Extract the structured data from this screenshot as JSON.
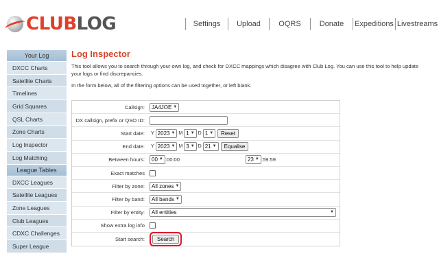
{
  "logo": {
    "club": "CLUB",
    "log": "LOG"
  },
  "topnav": [
    "Settings",
    "Upload",
    "OQRS",
    "Donate",
    "Expeditions",
    "Livestreams"
  ],
  "sidebar": {
    "your_log_header": "Your Log",
    "your_log_items": [
      "DXCC Charts",
      "Satellite Charts",
      "Timelines",
      "Grid Squares",
      "QSL Charts",
      "Zone Charts",
      "Log Inspector",
      "Log Matching"
    ],
    "league_header": "League Tables",
    "league_items": [
      "DXCC Leagues",
      "Satellite Leagues",
      "Zone Leagues",
      "Club Leagues",
      "CDXC Challenges",
      "Super League"
    ]
  },
  "main": {
    "title": "Log Inspector",
    "intro": "This tool allows you to search through your own log, and check for DXCC mappings which disagree with Club Log. You can use this tool to help update your logs or find discrepancies.",
    "intro2": "In the form below, all of the filtering options can be used together, or left blank."
  },
  "form": {
    "callsign_label": "Callsign:",
    "callsign_value": "JA4JOE",
    "dx_label": "DX callsign, prefix or QSO ID:",
    "dx_value": "",
    "start_label": "Start date:",
    "end_label": "End date:",
    "y_label": "Y",
    "m_label": "M",
    "d_label": "D",
    "start_year": "2023",
    "start_month": "1",
    "start_day": "1",
    "end_year": "2023",
    "end_month": "3",
    "end_day": "21",
    "reset_label": "Reset",
    "equalise_label": "Equalise",
    "hours_label": "Between hours:",
    "hour_from": "00",
    "time_from_suffix": ":00:00",
    "hour_to": "23",
    "time_to_suffix": ":59:59",
    "exact_label": "Exact matches",
    "zone_label": "Filter by zone:",
    "zone_value": "All zones",
    "band_label": "Filter by band:",
    "band_value": "All bands",
    "entity_label": "Filter by entity:",
    "entity_value": "All entities",
    "extra_label": "Show extra log info",
    "search_label": "Start search:",
    "search_button": "Search"
  },
  "colors": {
    "accent": "#e0402a",
    "title": "#d2462b",
    "highlight": "#e0162b",
    "sidebar": "#dbe6ef"
  }
}
